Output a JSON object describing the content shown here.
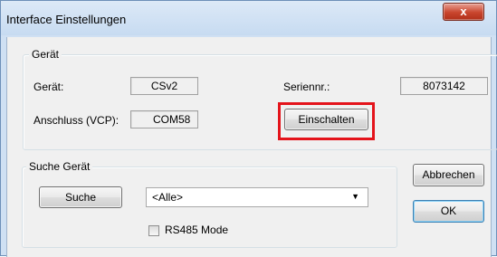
{
  "window": {
    "title": "Interface Einstellungen",
    "close_symbol": "x"
  },
  "device_group": {
    "legend": "Gerät",
    "device_label": "Gerät:",
    "device_value": "CSv2",
    "serial_label": "Seriennr.:",
    "serial_value": "8073142",
    "port_label": "Anschluss (VCP):",
    "port_value": "COM58",
    "power_on_button": "Einschalten"
  },
  "search_group": {
    "legend": "Suche Gerät",
    "search_button": "Suche",
    "filter_selected": "<Alle>",
    "rs485_label": "RS485 Mode",
    "rs485_checked": false
  },
  "actions": {
    "cancel_button": "Abbrechen",
    "ok_button": "OK"
  },
  "colors": {
    "highlight": "#e4141b",
    "close_button": "#c9452d"
  }
}
